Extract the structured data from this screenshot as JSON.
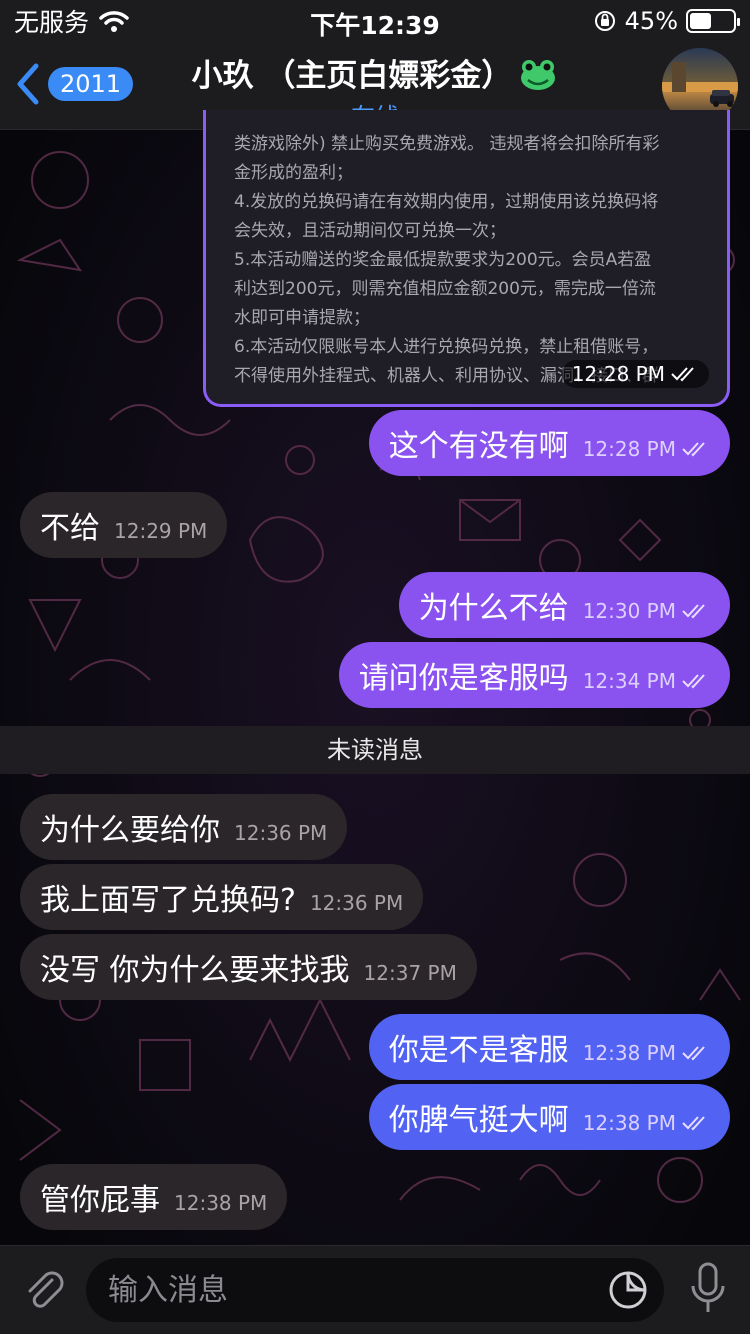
{
  "status": {
    "carrier": "无服务",
    "time": "下午12:39",
    "battery": "45%",
    "battery_level": 0.45
  },
  "header": {
    "back_count": "2011",
    "title": "小玖 （主页白嫖彩金）",
    "status": "在线"
  },
  "quoted": {
    "lines": [
      "类游戏除外) 禁止购买免费游戏。 违规者将会扣除所有彩",
      "金形成的盈利；",
      "4.发放的兑换码请在有效期内使用，过期使用该兑换码将",
      "会失效，且活动期间仅可兑换一次；",
      "5.本活动赠送的奖金最低提款要求为200元。会员A若盈",
      "利达到200元，则需充值相应金额200元，需完成一倍流",
      "水即可申请提款；",
      "6.本活动仅限账号本人进行兑换码兑换，禁止租借账号，",
      "不得使用外挂程式、机器人、利用协议、漏洞、接口、群"
    ],
    "time": "12:28 PM"
  },
  "messages": [
    {
      "dir": "out",
      "text": "这个有没有啊",
      "time": "12:28 PM"
    },
    {
      "dir": "in",
      "text": "不给",
      "time": "12:29 PM"
    },
    {
      "dir": "out",
      "text": "为什么不给",
      "time": "12:30 PM"
    },
    {
      "dir": "out",
      "text": "请问你是客服吗",
      "time": "12:34 PM"
    },
    {
      "dir": "in",
      "text": "为什么要给你",
      "time": "12:36 PM"
    },
    {
      "dir": "in",
      "text": "我上面写了兑换码?",
      "time": "12:36 PM"
    },
    {
      "dir": "in",
      "text": "没写 你为什么要来找我",
      "time": "12:37 PM"
    },
    {
      "dir": "out",
      "text": "你是不是客服",
      "time": "12:38 PM"
    },
    {
      "dir": "out",
      "text": "你脾气挺大啊",
      "time": "12:38 PM"
    },
    {
      "dir": "in",
      "text": "管你屁事",
      "time": "12:38 PM"
    }
  ],
  "divider": "未读消息",
  "input": {
    "placeholder": "输入消息"
  },
  "colors": {
    "outgoing_purple": "#8a53f0",
    "outgoing_blue": "#5263f3",
    "incoming": "#2b2629",
    "accent": "#3a8bf5"
  },
  "icons": [
    "wifi-icon",
    "back-chevron-icon",
    "frog-emoji-icon",
    "double-check-icon",
    "paperclip-icon",
    "sticker-icon",
    "microphone-icon"
  ]
}
